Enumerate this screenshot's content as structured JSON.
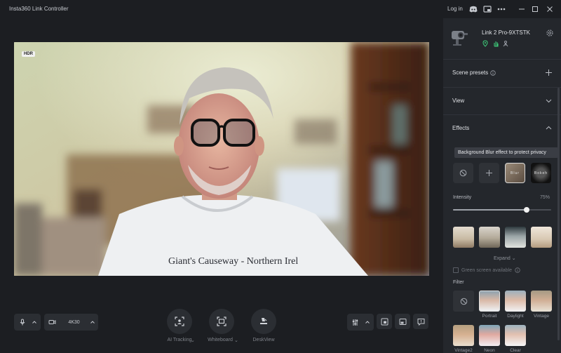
{
  "app": {
    "title": "Insta360 Link Controller"
  },
  "top": {
    "login": "Log in"
  },
  "preview": {
    "hdr": "HDR"
  },
  "bottom": {
    "resolution": "4K30",
    "ai_tracking": "AI Tracking",
    "whiteboard": "Whiteboard",
    "deskview": "DeskView"
  },
  "panel": {
    "device_name": "Link 2 Pro-9XTSTK",
    "scene_presets": "Scene presets",
    "view": "View",
    "effects": "Effects",
    "tooltip": "Background Blur effect to protect privacy",
    "blur_label": "Blur",
    "bokeh_label": "Bokeh",
    "intensity_label": "Intensity",
    "intensity_value": "75%",
    "intensity": 0.75,
    "expand": "Expand",
    "green_screen": "Green screen available",
    "filter_title": "Filter",
    "filters": [
      "Portrait",
      "Daylight",
      "Vintage",
      "Vintage2",
      "Neon",
      "Clear"
    ]
  },
  "colors": {
    "background": "#1c1e22",
    "panel": "#24272c",
    "accent_green": "#3ed17c"
  }
}
